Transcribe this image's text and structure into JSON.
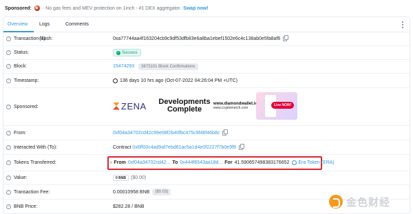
{
  "sponsor_bar": {
    "label": "Sponsored:",
    "text": "- No gas fees and MEV protection on 1inch - #1 DEX aggregator.",
    "cta": "Swap now!"
  },
  "tabs": [
    {
      "label": "Overview",
      "active": true
    },
    {
      "label": "Logs (1)",
      "active": false
    },
    {
      "label": "Comments",
      "active": false
    }
  ],
  "rows": {
    "tx_hash": {
      "label": "Transaction Hash:",
      "value": "0xa77744aa4f163204cb9c9df53dfb83e6a8ba1ebef1502e6c4c138ab0e5fa8af6"
    },
    "status": {
      "label": "Status:",
      "value": "Success"
    },
    "block": {
      "label": "Block:",
      "value": "15474293",
      "confirmations": "3873101 Block Confirmations"
    },
    "timestamp": {
      "label": "Timestamp:",
      "value": "136 days 10 hrs ago (Oct-07-2022 04:26:04 PM +UTC)"
    },
    "sponsored": {
      "label": "Sponsored:",
      "brand": "ZENA",
      "headline_1": "Developments",
      "headline_2": "Complete",
      "site_1": "www.diamondwallet.io",
      "site_2": "www.cryptomerch.com",
      "live": "Live NOW!"
    },
    "from": {
      "label": "From:",
      "value": "0xf04a34702cd42c99e08f2b40fbc475c9f46f46b8c"
    },
    "interacted": {
      "label": "Interacted With (To):",
      "prefix": "Contract",
      "value": "0x6ff00c4ad9af7ebd61ac5a1d4e0f2227f7b0e9f9"
    },
    "tokens": {
      "label": "Tokens Transferred:",
      "from_label": "From",
      "from_value": "0xf04a34702cd42...",
      "to_label": "To",
      "to_value": "0x444f6543aa18d...",
      "for_label": "For",
      "amount": "41.590657498383176652",
      "token": "Era Token (ERA)"
    },
    "value": {
      "label": "Value:",
      "value": "0 BNB",
      "usd": "($0.00)"
    },
    "fee": {
      "label": "Transaction Fee:",
      "value": "0.00010958 BNB",
      "usd": "($0.03)"
    },
    "price": {
      "label": "BNB Price:",
      "value": "$282.28 / BNB"
    }
  },
  "watermark": "金色财经"
}
